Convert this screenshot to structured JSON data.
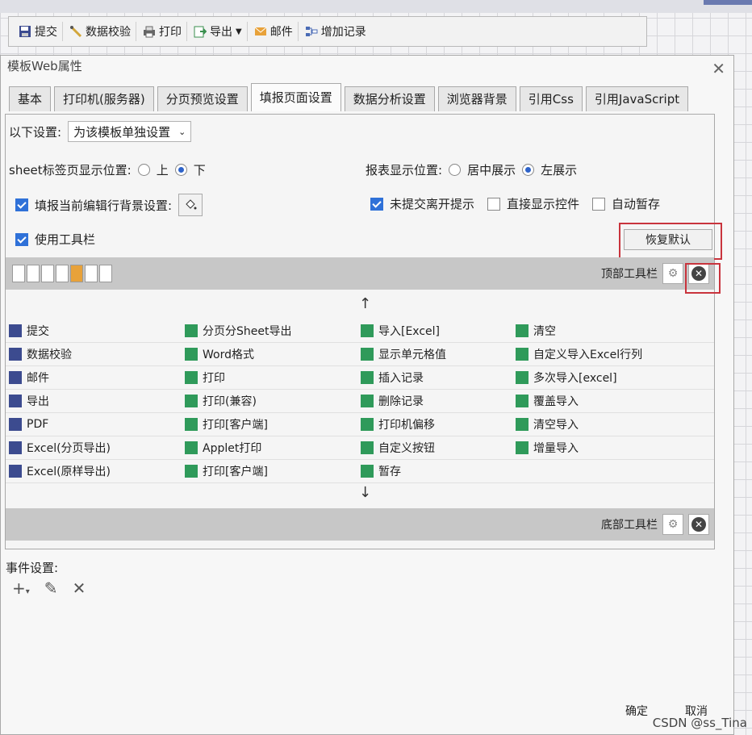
{
  "toolbar": {
    "submit": "提交",
    "validate": "数据校验",
    "print": "打印",
    "export": "导出",
    "mail": "邮件",
    "add_record": "增加记录"
  },
  "dialog": {
    "title": "模板Web属性",
    "tabs": [
      "基本",
      "打印机(服务器)",
      "分页预览设置",
      "填报页面设置",
      "数据分析设置",
      "浏览器背景",
      "引用Css",
      "引用JavaScript"
    ],
    "setting_label": "以下设置:",
    "setting_value": "为该模板单独设置",
    "sheet_pos_label": "sheet标签页显示位置:",
    "sheet_pos_options": [
      "上",
      "下"
    ],
    "report_pos_label": "报表显示位置:",
    "report_pos_options": [
      "居中展示",
      "左展示"
    ],
    "bg_setting_label": "填报当前编辑行背景设置:",
    "leave_prompt": "未提交离开提示",
    "direct_show": "直接显示控件",
    "auto_save": "自动暂存",
    "use_toolbar": "使用工具栏",
    "restore_default": "恢复默认",
    "top_toolbar": "顶部工具栏",
    "bottom_toolbar": "底部工具栏",
    "events_label": "事件设置:",
    "ok": "确定",
    "cancel": "取消"
  },
  "buttons_grid": [
    [
      "提交",
      "分页分Sheet导出",
      "导入[Excel]",
      "清空"
    ],
    [
      "数据校验",
      "Word格式",
      "显示单元格值",
      "自定义导入Excel行列"
    ],
    [
      "邮件",
      "打印",
      "插入记录",
      "多次导入[excel]"
    ],
    [
      "导出",
      "打印(兼容)",
      "删除记录",
      "覆盖导入"
    ],
    [
      "PDF",
      "打印[客户端]",
      "打印机偏移",
      "清空导入"
    ],
    [
      "Excel(分页导出)",
      "Applet打印",
      "自定义按钮",
      "增量导入"
    ],
    [
      "Excel(原样导出)",
      "打印[客户端]",
      "暂存",
      ""
    ]
  ],
  "colors": {
    "accent": "#2f71d8",
    "highlight": "#c9343d",
    "bar": "#c7c7c7"
  },
  "watermark": "CSDN @ss_Tina"
}
